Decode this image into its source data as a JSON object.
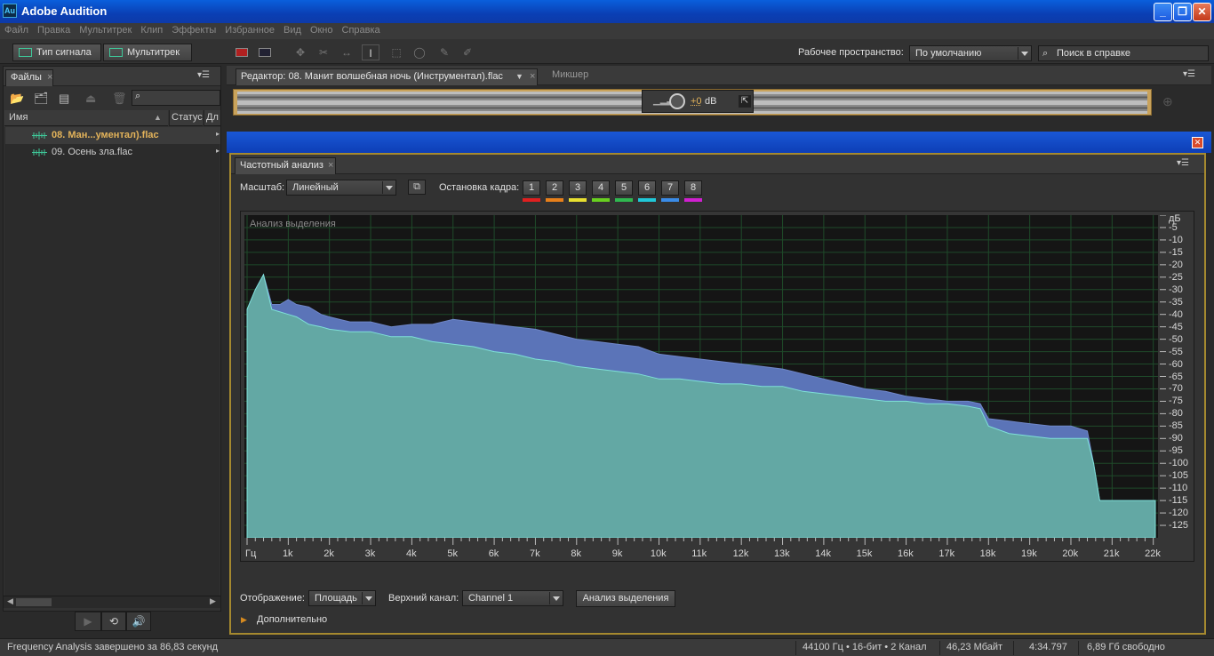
{
  "app": {
    "title": "Adobe Audition",
    "logo": "Au"
  },
  "menu": [
    "Файл",
    "Правка",
    "Мультитрек",
    "Клип",
    "Эффекты",
    "Избранное",
    "Вид",
    "Окно",
    "Справка"
  ],
  "toolbar": {
    "waveform_mode": "Тип сигнала",
    "multitrack_mode": "Мультитрек",
    "workspace_label": "Рабочее пространство:",
    "workspace_value": "По умолчанию",
    "help_search_placeholder": "Поиск в справке"
  },
  "files_panel": {
    "tab": "Файлы",
    "columns": {
      "name": "Имя",
      "status": "Статус",
      "duration": "Дл"
    },
    "files": [
      {
        "name": "08. Ман...ументал).flac",
        "selected": true
      },
      {
        "name": "09. Осень зла.flac",
        "selected": false
      }
    ]
  },
  "editor": {
    "tab": "Редактор: 08. Манит волшебная ночь (Инструментал).flac",
    "mixer_tab": "Микшер",
    "hud_gain": "+0",
    "hud_unit": "dB"
  },
  "frequency_analysis": {
    "tab": "Частотный анализ",
    "scale_label": "Масштаб:",
    "scale_value": "Линейный",
    "hold_label": "Остановка кадра:",
    "hold_buttons": [
      {
        "label": "1",
        "color": "#e02020"
      },
      {
        "label": "2",
        "color": "#e8801a"
      },
      {
        "label": "3",
        "color": "#e8e030"
      },
      {
        "label": "4",
        "color": "#68d020"
      },
      {
        "label": "5",
        "color": "#30b850"
      },
      {
        "label": "6",
        "color": "#20c8d8"
      },
      {
        "label": "7",
        "color": "#3a8ce8"
      },
      {
        "label": "8",
        "color": "#d020d0"
      }
    ],
    "plot_caption": "Анализ выделения",
    "display_label": "Отображение:",
    "display_value": "Площадь",
    "channel_label": "Верхний канал:",
    "channel_value": "Channel 1",
    "analyze_button": "Анализ выделения",
    "advanced_label": "Дополнительно"
  },
  "chart_data": {
    "type": "area",
    "xlabel": "Гц",
    "x_tick_labels": [
      "Гц",
      "1k",
      "2k",
      "3k",
      "4k",
      "5k",
      "6k",
      "7k",
      "8k",
      "9k",
      "10k",
      "11k",
      "12k",
      "13k",
      "14k",
      "15k",
      "16k",
      "17k",
      "18k",
      "19k",
      "20k",
      "21k",
      "22k"
    ],
    "xlim": [
      0,
      22050
    ],
    "ylabel": "дБ",
    "y_ticks": [
      -5,
      -10,
      -15,
      -20,
      -25,
      -30,
      -35,
      -40,
      -45,
      -50,
      -55,
      -60,
      -65,
      -70,
      -75,
      -80,
      -85,
      -90,
      -95,
      -100,
      -105,
      -110,
      -115,
      -120,
      -125
    ],
    "ylim": [
      -130,
      0
    ],
    "grid": true,
    "series": [
      {
        "color": "#5b74b8",
        "x": [
          0,
          200,
          400,
          600,
          800,
          1000,
          1200,
          1500,
          1800,
          2000,
          2500,
          3000,
          3500,
          4000,
          4500,
          5000,
          5500,
          6000,
          6500,
          7000,
          7500,
          8000,
          8500,
          9000,
          9500,
          10000,
          10500,
          11000,
          11500,
          12000,
          12500,
          13000,
          13500,
          14000,
          14500,
          15000,
          15500,
          16000,
          16500,
          17000,
          17500,
          17800,
          18000,
          18500,
          19000,
          19500,
          20000,
          20400,
          20550,
          20700,
          21000,
          21500,
          22050
        ],
        "y": [
          -38,
          -30,
          -24,
          -36,
          -36,
          -34,
          -36,
          -37,
          -40,
          -41,
          -43,
          -43,
          -45,
          -44,
          -44,
          -42,
          -43,
          -44,
          -45,
          -46,
          -48,
          -50,
          -51,
          -52,
          -53,
          -56,
          -57,
          -58,
          -59,
          -60,
          -61,
          -62,
          -64,
          -66,
          -68,
          -70,
          -71,
          -73,
          -74,
          -75,
          -75,
          -76,
          -82,
          -83,
          -84,
          -85,
          -85,
          -87,
          -100,
          -115,
          -115,
          -115,
          -115
        ]
      },
      {
        "color": "#63a8a4",
        "x": [
          0,
          200,
          400,
          600,
          800,
          1000,
          1200,
          1500,
          1800,
          2000,
          2500,
          3000,
          3500,
          4000,
          4500,
          5000,
          5500,
          6000,
          6500,
          7000,
          7500,
          8000,
          8500,
          9000,
          9500,
          10000,
          10500,
          11000,
          11500,
          12000,
          12500,
          13000,
          13500,
          14000,
          14500,
          15000,
          15500,
          16000,
          16500,
          17000,
          17500,
          17800,
          18000,
          18500,
          19000,
          19500,
          20000,
          20400,
          20550,
          20700,
          21000,
          21500,
          22050
        ],
        "y": [
          -38,
          -30,
          -24,
          -38,
          -39,
          -40,
          -41,
          -44,
          -45,
          -46,
          -47,
          -47,
          -49,
          -49,
          -51,
          -52,
          -53,
          -55,
          -56,
          -58,
          -59,
          -61,
          -62,
          -63,
          -64,
          -66,
          -66,
          -67,
          -68,
          -68,
          -69,
          -69,
          -71,
          -72,
          -73,
          -74,
          -75,
          -75,
          -76,
          -76,
          -77,
          -78,
          -85,
          -88,
          -89,
          -90,
          -90,
          -90,
          -100,
          -115,
          -115,
          -115,
          -115
        ]
      }
    ]
  },
  "status": {
    "message": "Frequency Analysis завершено за 86,83 секунд",
    "format": "44100 Гц • 16-бит • 2 Канал",
    "size": "46,23 Мбайт",
    "duration": "4:34.797",
    "free": "6,89 Гб свободно"
  }
}
